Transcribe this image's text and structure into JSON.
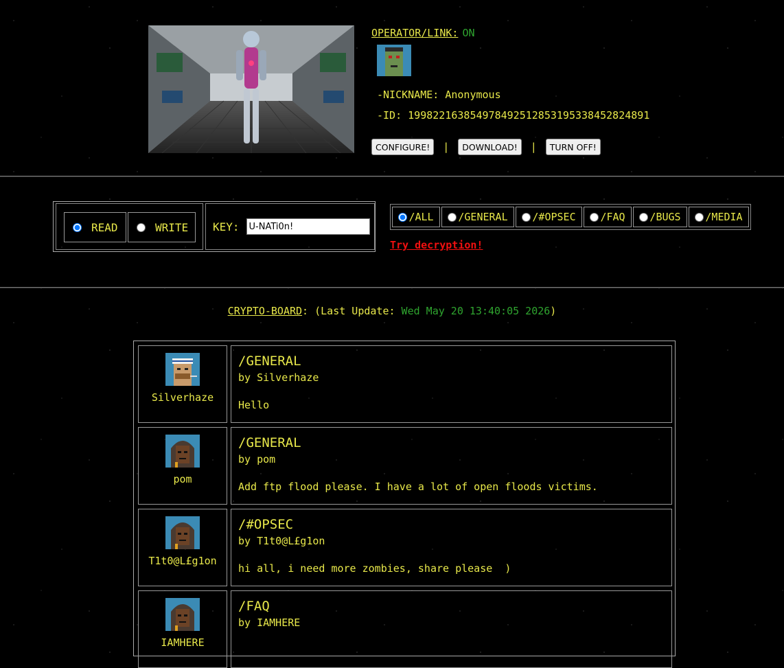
{
  "status": {
    "operator_label": "OPERATOR/LINK:",
    "operator_state": "ON",
    "nickname_line": "-NICKNAME: Anonymous",
    "id_line": "-ID: 19982216385497849251285319533845282489​1"
  },
  "actions": {
    "configure": "CONFIGURE!",
    "download": "DOWNLOAD!",
    "turn_off": "TURN OFF!",
    "separator": "|"
  },
  "mode": {
    "read": "READ",
    "write": "WRITE",
    "selected": "READ"
  },
  "key": {
    "label": "KEY:",
    "value": "U-NATi0n!"
  },
  "boards": {
    "items": [
      "/ALL",
      "/GENERAL",
      "/#OPSEC",
      "/FAQ",
      "/BUGS",
      "/MEDIA"
    ],
    "selected": "/ALL"
  },
  "decrypt_link": "Try decryption!",
  "board": {
    "name": "CRYPTO-BOARD",
    "mid": ": (Last Update: ",
    "updated": "Wed May 20 13:40:05 2026",
    "end": ")"
  },
  "posts": [
    {
      "user": "Silverhaze",
      "board": "/GENERAL",
      "by": "by Silverhaze",
      "message": "Hello",
      "avatar": "bandana-avatar-icon"
    },
    {
      "user": "pom",
      "board": "/GENERAL",
      "by": "by pom",
      "message": "Add ftp flood please. I have a lot of open floods victims.",
      "avatar": "hooded-avatar-icon"
    },
    {
      "user": "T1t0@L£g1on",
      "board": "/#OPSEC",
      "by": "by T1t0@L£g1on",
      "message": "hi all, i need more zombies, share please  )",
      "avatar": "hooded-avatar-icon"
    },
    {
      "user": "IAMHERE",
      "board": "/FAQ",
      "by": "by IAMHERE",
      "message": "",
      "avatar": "hooded-avatar-icon"
    }
  ],
  "colors": {
    "text": "#e8e84a",
    "online": "#2fa52f",
    "link_alert": "#f01010",
    "background": "#000000"
  }
}
